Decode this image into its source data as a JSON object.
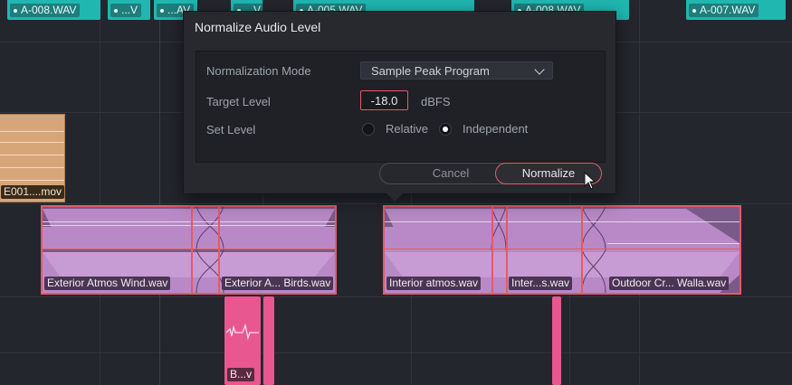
{
  "timeline": {
    "top_clips": [
      {
        "label": "A-008.WAV"
      },
      {
        "label": "...V"
      },
      {
        "label": "...AV"
      },
      {
        "label": "...V"
      },
      {
        "label": "A-005.WAV"
      },
      {
        "label": "A-008.WAV"
      },
      {
        "label": "A-007.WAV"
      }
    ],
    "video_clip": {
      "label": "E001....mov"
    },
    "audio_clips": [
      {
        "label_a": "Exterior Atmos Wind.wav",
        "label_b": "Exterior A... Birds.wav"
      },
      {
        "label_a": "Interior atmos.wav",
        "label_b": "Inter...s.wav",
        "label_c": "Outdoor Cr... Walla.wav"
      }
    ],
    "pink_clips": [
      {
        "label": "B...v"
      }
    ]
  },
  "dialog": {
    "title": "Normalize Audio Level",
    "mode_label": "Normalization Mode",
    "mode_value": "Sample Peak Program",
    "target_label": "Target Level",
    "target_value": "-18.0",
    "target_unit": "dBFS",
    "set_level_label": "Set Level",
    "option_relative": "Relative",
    "option_independent": "Independent",
    "selected_option": "Independent",
    "cancel_label": "Cancel",
    "normalize_label": "Normalize"
  },
  "colors": {
    "accent": "#e35b66",
    "teal": "#1fb7b0",
    "purple": "#b889c6",
    "pink": "#e8578f",
    "tan": "#d7a57a"
  }
}
